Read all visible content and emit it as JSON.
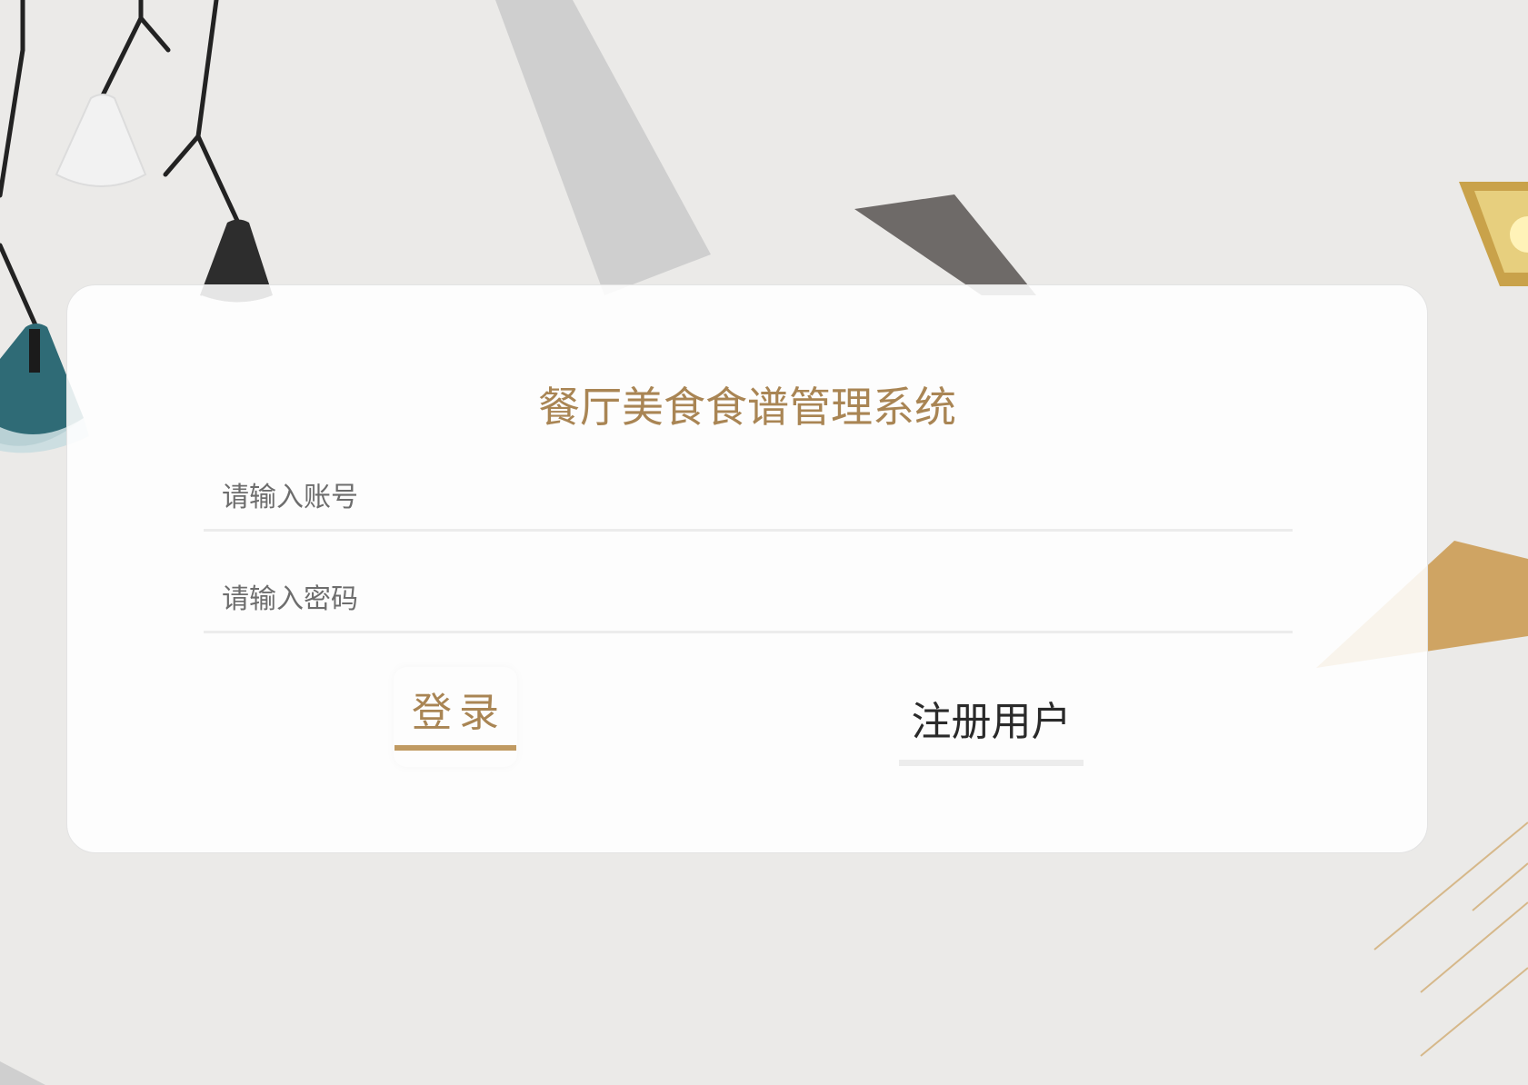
{
  "app": {
    "title": "餐厅美食食谱管理系统"
  },
  "login_form": {
    "account_placeholder": "请输入账号",
    "account_value": "",
    "password_placeholder": "请输入密码",
    "password_value": "",
    "login_label": "登录",
    "register_label": "注册用户"
  },
  "colors": {
    "background": "#ebeae8",
    "accent": "#a98554",
    "underline_active": "#c09a62",
    "underline_inactive": "#ececec",
    "card": "#ffffff"
  },
  "icons": [
    "pendant-lamp-icon",
    "gold-frame-decor"
  ]
}
